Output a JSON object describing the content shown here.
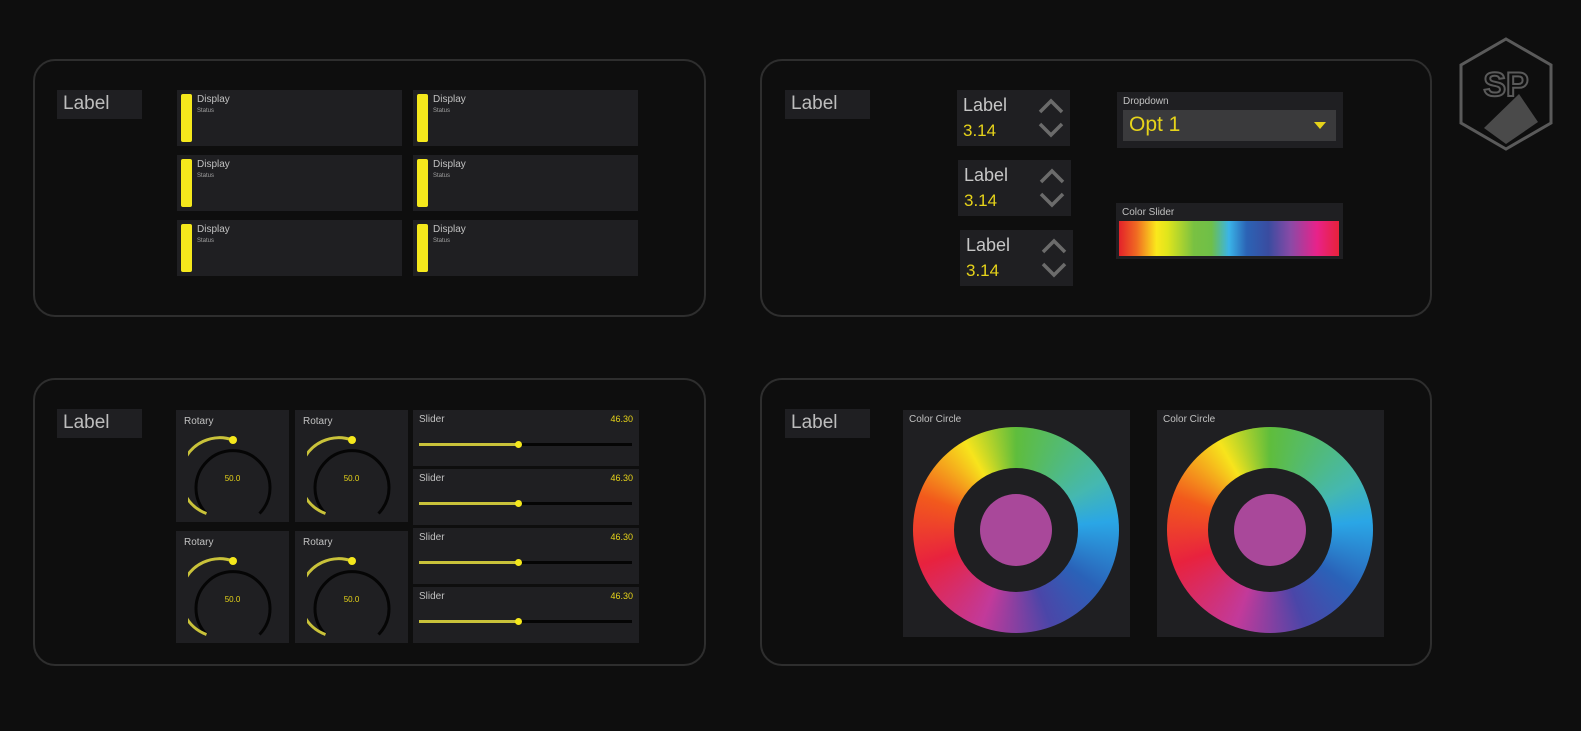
{
  "colors": {
    "accent": "#f5e81c",
    "value_text": "#e6d31a",
    "panel_bg": "#1f1f22",
    "border": "#2e2e2e"
  },
  "logo": {
    "text": "SP"
  },
  "panel_top_left": {
    "label": "Label",
    "displays": [
      {
        "title": "Display",
        "status": "Status"
      },
      {
        "title": "Display",
        "status": "Status"
      },
      {
        "title": "Display",
        "status": "Status"
      },
      {
        "title": "Display",
        "status": "Status"
      },
      {
        "title": "Display",
        "status": "Status"
      },
      {
        "title": "Display",
        "status": "Status"
      }
    ]
  },
  "panel_top_right": {
    "label": "Label",
    "spinners": [
      {
        "label": "Label",
        "value": "3.14"
      },
      {
        "label": "Label",
        "value": "3.14"
      },
      {
        "label": "Label",
        "value": "3.14"
      }
    ],
    "dropdown": {
      "title": "Dropdown",
      "value": "Opt 1"
    },
    "color_slider": {
      "title": "Color Slider"
    }
  },
  "panel_bottom_left": {
    "label": "Label",
    "rotaries": [
      {
        "title": "Rotary",
        "value": "50.0",
        "level": 0.5
      },
      {
        "title": "Rotary",
        "value": "50.0",
        "level": 0.5
      },
      {
        "title": "Rotary",
        "value": "50.0",
        "level": 0.5
      },
      {
        "title": "Rotary",
        "value": "50.0",
        "level": 0.5
      }
    ],
    "sliders": [
      {
        "title": "Slider",
        "value": "46.30",
        "level": 0.463
      },
      {
        "title": "Slider",
        "value": "46.30",
        "level": 0.463
      },
      {
        "title": "Slider",
        "value": "46.30",
        "level": 0.463
      },
      {
        "title": "Slider",
        "value": "46.30",
        "level": 0.463
      }
    ]
  },
  "panel_bottom_right": {
    "label": "Label",
    "color_circles": [
      {
        "title": "Color Circle",
        "selected_color": "#a9489a"
      },
      {
        "title": "Color Circle",
        "selected_color": "#a9489a"
      }
    ]
  }
}
